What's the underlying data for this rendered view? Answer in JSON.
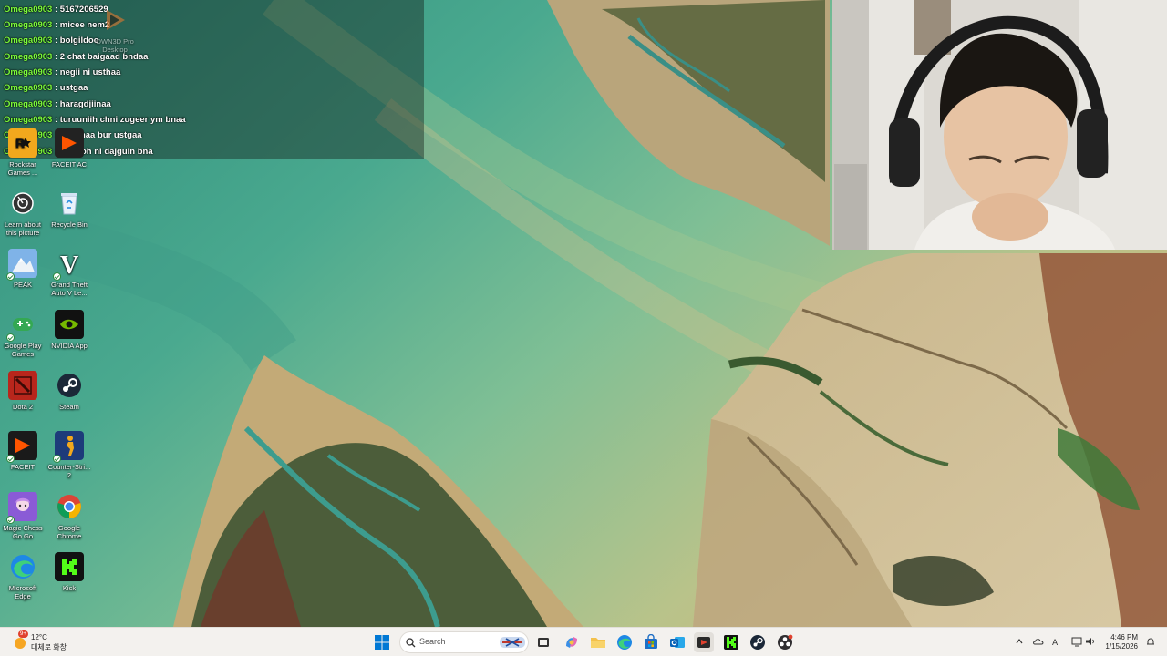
{
  "chat": {
    "messages": [
      {
        "user": "Omega0903",
        "text": "5167206529"
      },
      {
        "user": "Omega0903",
        "text": "micee nem2"
      },
      {
        "user": "Omega0903",
        "text": "bolgildoo"
      },
      {
        "user": "Omega0903",
        "text": "2 chat baigaad bndaa"
      },
      {
        "user": "Omega0903",
        "text": "negii ni usthaa"
      },
      {
        "user": "Omega0903",
        "text": "ustgaa"
      },
      {
        "user": "Omega0903",
        "text": "haragdjiinaa"
      },
      {
        "user": "Omega0903",
        "text": "turuuniih chni zugeer ym bnaa"
      },
      {
        "user": "Omega0903",
        "text": "naadhaa bur ustgaa"
      },
      {
        "user": "Omega0903",
        "text": "nogooh ni dajguin bna"
      }
    ],
    "separator": ":"
  },
  "desktop": {
    "icons": [
      {
        "label": "OWN3D Pro Desktop",
        "icon": "own3d-icon"
      },
      {
        "label": "Rockstar Games ...",
        "icon": "rockstar-icon"
      },
      {
        "label": "FACEIT AC",
        "icon": "faceit-ac-icon"
      },
      {
        "label": "Learn about this picture",
        "icon": "camera-icon"
      },
      {
        "label": "Recycle Bin",
        "icon": "recycle-bin-icon"
      },
      {
        "label": "PEAK",
        "icon": "peak-icon"
      },
      {
        "label": "Grand Theft Auto V Le...",
        "icon": "gta-icon"
      },
      {
        "label": "Google Play Games",
        "icon": "google-play-games-icon"
      },
      {
        "label": "NVIDIA App",
        "icon": "nvidia-icon"
      },
      {
        "label": "Dota 2",
        "icon": "dota2-icon"
      },
      {
        "label": "Steam",
        "icon": "steam-icon"
      },
      {
        "label": "FACEIT",
        "icon": "faceit-icon"
      },
      {
        "label": "Counter-Stri... 2",
        "icon": "counter-strike-icon"
      },
      {
        "label": "Magic Chess Go Go",
        "icon": "magic-chess-icon"
      },
      {
        "label": "Google Chrome",
        "icon": "chrome-icon"
      },
      {
        "label": "Microsoft Edge",
        "icon": "edge-icon"
      },
      {
        "label": "Kick",
        "icon": "kick-icon"
      }
    ]
  },
  "taskbar": {
    "weather": {
      "temp": "12°C",
      "desc": "대체로 화창",
      "badge": "9+"
    },
    "search_placeholder": "Search",
    "apps": [
      "windows-start-icon",
      "search-icon",
      "task-view-icon",
      "copilot-icon",
      "file-explorer-icon",
      "edge-icon",
      "microsoft-store-icon",
      "outlook-icon",
      "streaming-app-icon",
      "kick-icon",
      "steam-icon",
      "obs-icon"
    ],
    "clock": {
      "time": "4:46 PM",
      "date": "1/15/2026"
    }
  },
  "colors": {
    "chat_username": "#7cfc3a",
    "taskbar_bg": "#f3f1ee",
    "accent": "#0067c0"
  }
}
